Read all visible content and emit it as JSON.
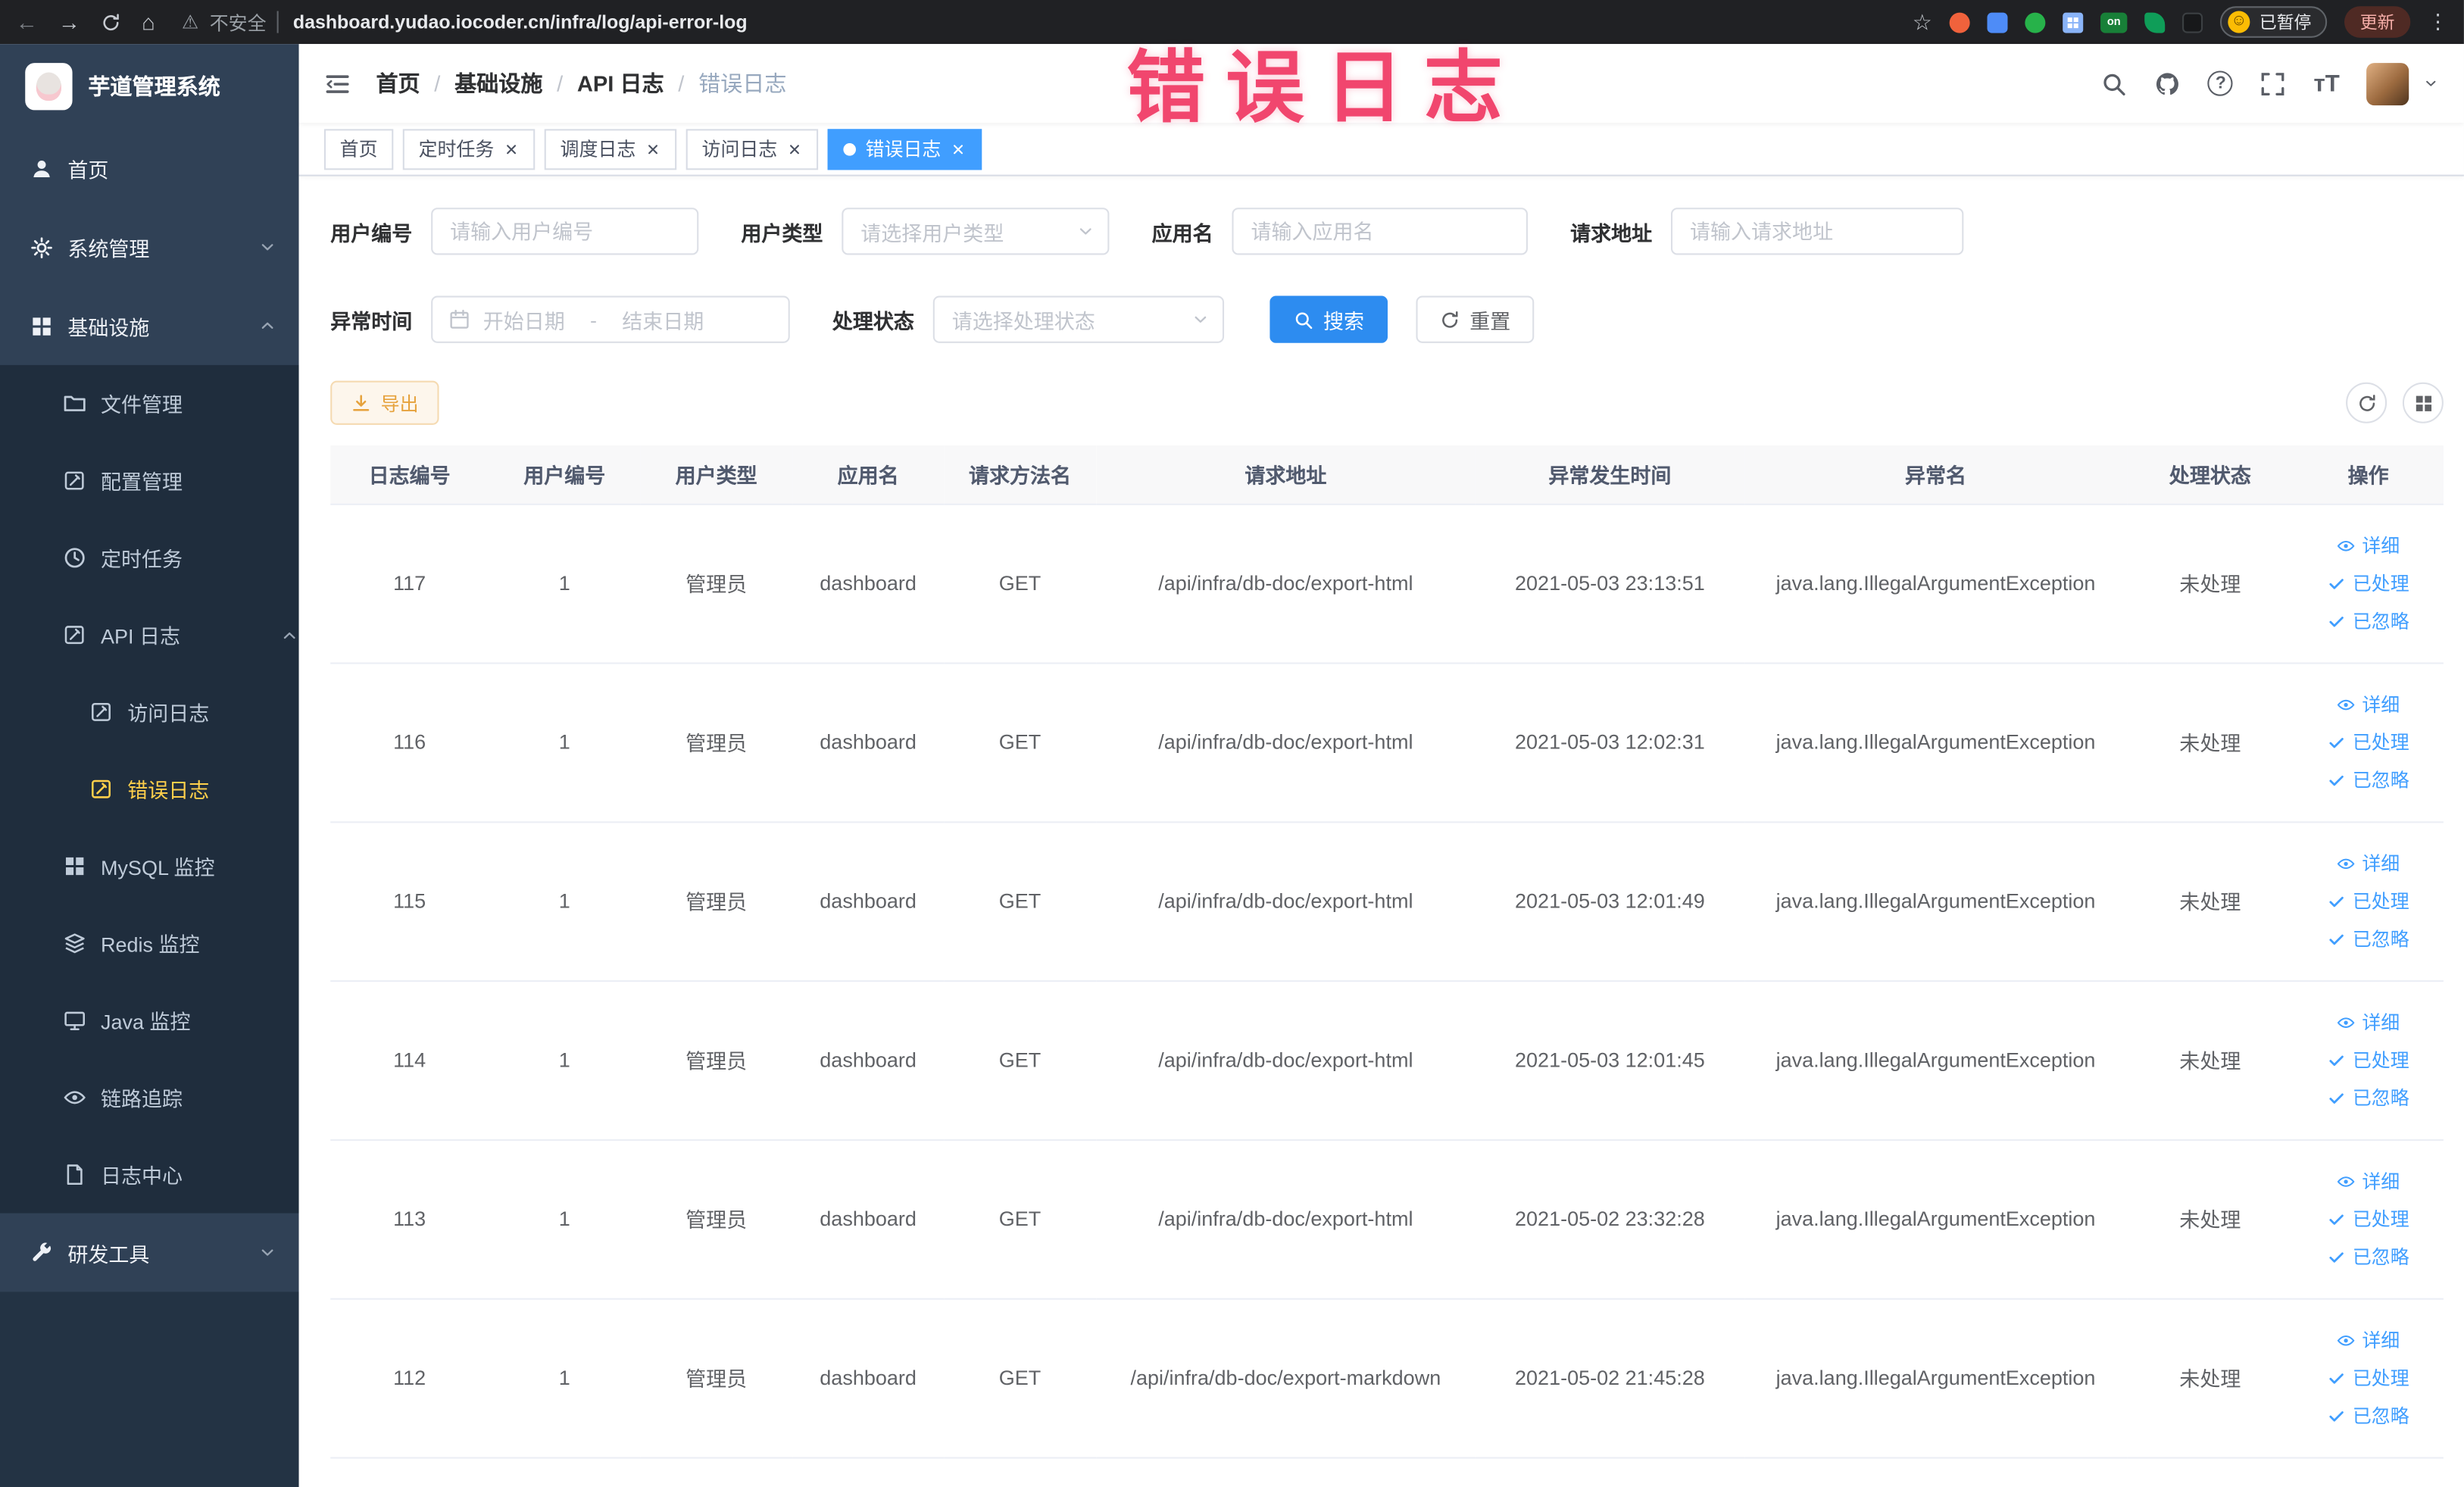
{
  "colors": {
    "primary": "#409eff",
    "search-btn": "#2d8cf0",
    "sidebar-bg": "#304156",
    "submenu-bg": "#1f2d3d",
    "sidebar-active": "#ffd04b",
    "warn-text": "#e6a23c",
    "warn-bg": "#fdf6ec",
    "warn-border": "#f5dab1",
    "overlay-pink": "#f1466e",
    "browser-bar": "#202124"
  },
  "browser": {
    "icons": {
      "back": "←",
      "forward": "→",
      "home": "⌂",
      "warning": "⚠",
      "star": "☆",
      "kebab": "⋮",
      "smiley": "☺"
    },
    "security_label": "不安全",
    "url": "dashboard.yudao.iocoder.cn/infra/log/api-error-log",
    "ext_on_badge": "on",
    "paused_button": "已暂停",
    "update_button": "更新"
  },
  "overlay_annotation": "错误日志",
  "sidebar": {
    "logo_title": "芋道管理系统",
    "menu": {
      "home": "首页",
      "system_mgmt": "系统管理",
      "infrastructure": "基础设施",
      "file_mgmt": "文件管理",
      "config_mgmt": "配置管理",
      "scheduled_jobs": "定时任务",
      "api_log": "API 日志",
      "access_log": "访问日志",
      "error_log": "错误日志",
      "mysql_monitor": "MySQL 监控",
      "redis_monitor": "Redis 监控",
      "java_monitor": "Java 监控",
      "trace": "链路追踪",
      "log_center": "日志中心",
      "dev_tools": "研发工具"
    }
  },
  "navbar": {
    "breadcrumb": [
      "首页",
      "基础设施",
      "API 日志",
      "错误日志"
    ],
    "breadcrumb_sep": "/",
    "icons": {
      "question": "?",
      "font_size": "тT"
    }
  },
  "tabs": [
    {
      "label": "首页"
    },
    {
      "label": "定时任务"
    },
    {
      "label": "调度日志"
    },
    {
      "label": "访问日志"
    },
    {
      "label": "错误日志"
    }
  ],
  "filters": {
    "user_id": {
      "label": "用户编号",
      "placeholder": "请输入用户编号"
    },
    "user_type": {
      "label": "用户类型",
      "placeholder": "请选择用户类型"
    },
    "app_name": {
      "label": "应用名",
      "placeholder": "请输入应用名"
    },
    "request_url": {
      "label": "请求地址",
      "placeholder": "请输入请求地址"
    },
    "exception_time": {
      "label": "异常时间",
      "start_placeholder": "开始日期",
      "separator": "-",
      "end_placeholder": "结束日期"
    },
    "process_status": {
      "label": "处理状态",
      "placeholder": "请选择处理状态"
    },
    "search_label": "搜索",
    "reset_label": "重置"
  },
  "toolbar": {
    "export_label": "导出"
  },
  "table": {
    "columns": [
      "日志编号",
      "用户编号",
      "用户类型",
      "应用名",
      "请求方法名",
      "请求地址",
      "异常发生时间",
      "异常名",
      "处理状态",
      "操作"
    ],
    "actions": {
      "detail": "详细",
      "processed": "已处理",
      "ignored": "已忽略"
    },
    "rows": [
      {
        "id": "117",
        "user_id": "1",
        "user_type": "管理员",
        "app_name": "dashboard",
        "method": "GET",
        "url": "/api/infra/db-doc/export-html",
        "time": "2021-05-03 23:13:51",
        "exception": "java.lang.IllegalArgumentException",
        "status": "未处理"
      },
      {
        "id": "116",
        "user_id": "1",
        "user_type": "管理员",
        "app_name": "dashboard",
        "method": "GET",
        "url": "/api/infra/db-doc/export-html",
        "time": "2021-05-03 12:02:31",
        "exception": "java.lang.IllegalArgumentException",
        "status": "未处理"
      },
      {
        "id": "115",
        "user_id": "1",
        "user_type": "管理员",
        "app_name": "dashboard",
        "method": "GET",
        "url": "/api/infra/db-doc/export-html",
        "time": "2021-05-03 12:01:49",
        "exception": "java.lang.IllegalArgumentException",
        "status": "未处理"
      },
      {
        "id": "114",
        "user_id": "1",
        "user_type": "管理员",
        "app_name": "dashboard",
        "method": "GET",
        "url": "/api/infra/db-doc/export-html",
        "time": "2021-05-03 12:01:45",
        "exception": "java.lang.IllegalArgumentException",
        "status": "未处理"
      },
      {
        "id": "113",
        "user_id": "1",
        "user_type": "管理员",
        "app_name": "dashboard",
        "method": "GET",
        "url": "/api/infra/db-doc/export-html",
        "time": "2021-05-02 23:32:28",
        "exception": "java.lang.IllegalArgumentException",
        "status": "未处理"
      },
      {
        "id": "112",
        "user_id": "1",
        "user_type": "管理员",
        "app_name": "dashboard",
        "method": "GET",
        "url": "/api/infra/db-doc/export-markdown",
        "time": "2021-05-02 21:45:28",
        "exception": "java.lang.IllegalArgumentException",
        "status": "未处理"
      }
    ]
  }
}
